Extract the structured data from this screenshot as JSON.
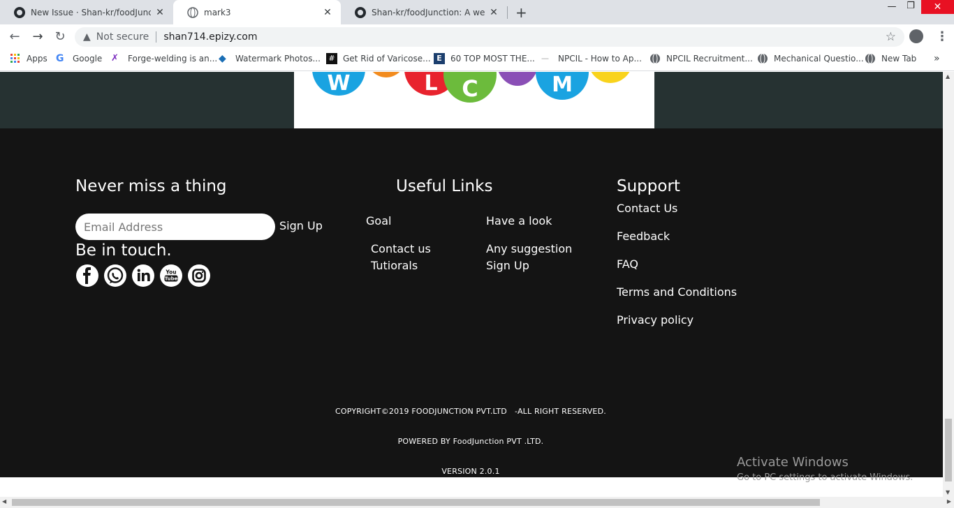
{
  "tabs": [
    {
      "title": "New Issue · Shan-kr/foodJunction",
      "icon": "github-icon"
    },
    {
      "title": "mark3",
      "icon": "globe-icon"
    },
    {
      "title": "Shan-kr/foodJunction: A website",
      "icon": "github-icon"
    }
  ],
  "toolbar": {
    "security": "Not secure",
    "url": "shan714.epizy.com"
  },
  "bookmarks": [
    {
      "label": "Apps",
      "icon": "apps-grid-icon"
    },
    {
      "label": "Google",
      "icon": "google-icon"
    },
    {
      "label": "Forge-welding is an...",
      "icon": "forge-icon"
    },
    {
      "label": "Watermark Photos...",
      "icon": "watermark-icon"
    },
    {
      "label": "Get Rid of Varicose...",
      "icon": "varicose-icon"
    },
    {
      "label": "60 TOP MOST THE...",
      "icon": "e-icon"
    },
    {
      "label": "NPCIL - How to Ap...",
      "icon": "npcil-icon"
    },
    {
      "label": "NPCIL Recruitment...",
      "icon": "globe-icon"
    },
    {
      "label": "Mechanical Questio...",
      "icon": "globe-icon"
    },
    {
      "label": "New Tab",
      "icon": "globe-icon"
    }
  ],
  "footer": {
    "newsletter_heading": "Never miss a thing",
    "email_placeholder": "Email Address",
    "signup_label": "Sign Up",
    "touch_heading": "Be in touch.",
    "useful_heading": "Useful Links",
    "useful_links": [
      "Goal",
      "Have a look",
      "Contact us",
      "Any suggestion",
      "Tutiorals",
      "Sign Up"
    ],
    "support_heading": "Support",
    "support_links": [
      "Contact Us",
      "Feedback",
      "FAQ",
      "Terms and Conditions",
      "Privacy policy"
    ],
    "copyright": "COPYRIGHT©2019 FOODJUNCTION PVT.LTD   -ALL RIGHT RESERVED.",
    "powered": "POWERED BY FoodJunction PVT .LTD.",
    "version": "VERSION 2.0.1"
  },
  "watermark": {
    "title": "Activate Windows",
    "subtitle": "Go to PC settings to activate Windows."
  },
  "colors": {
    "banner": "#263232",
    "footer": "#141414"
  }
}
